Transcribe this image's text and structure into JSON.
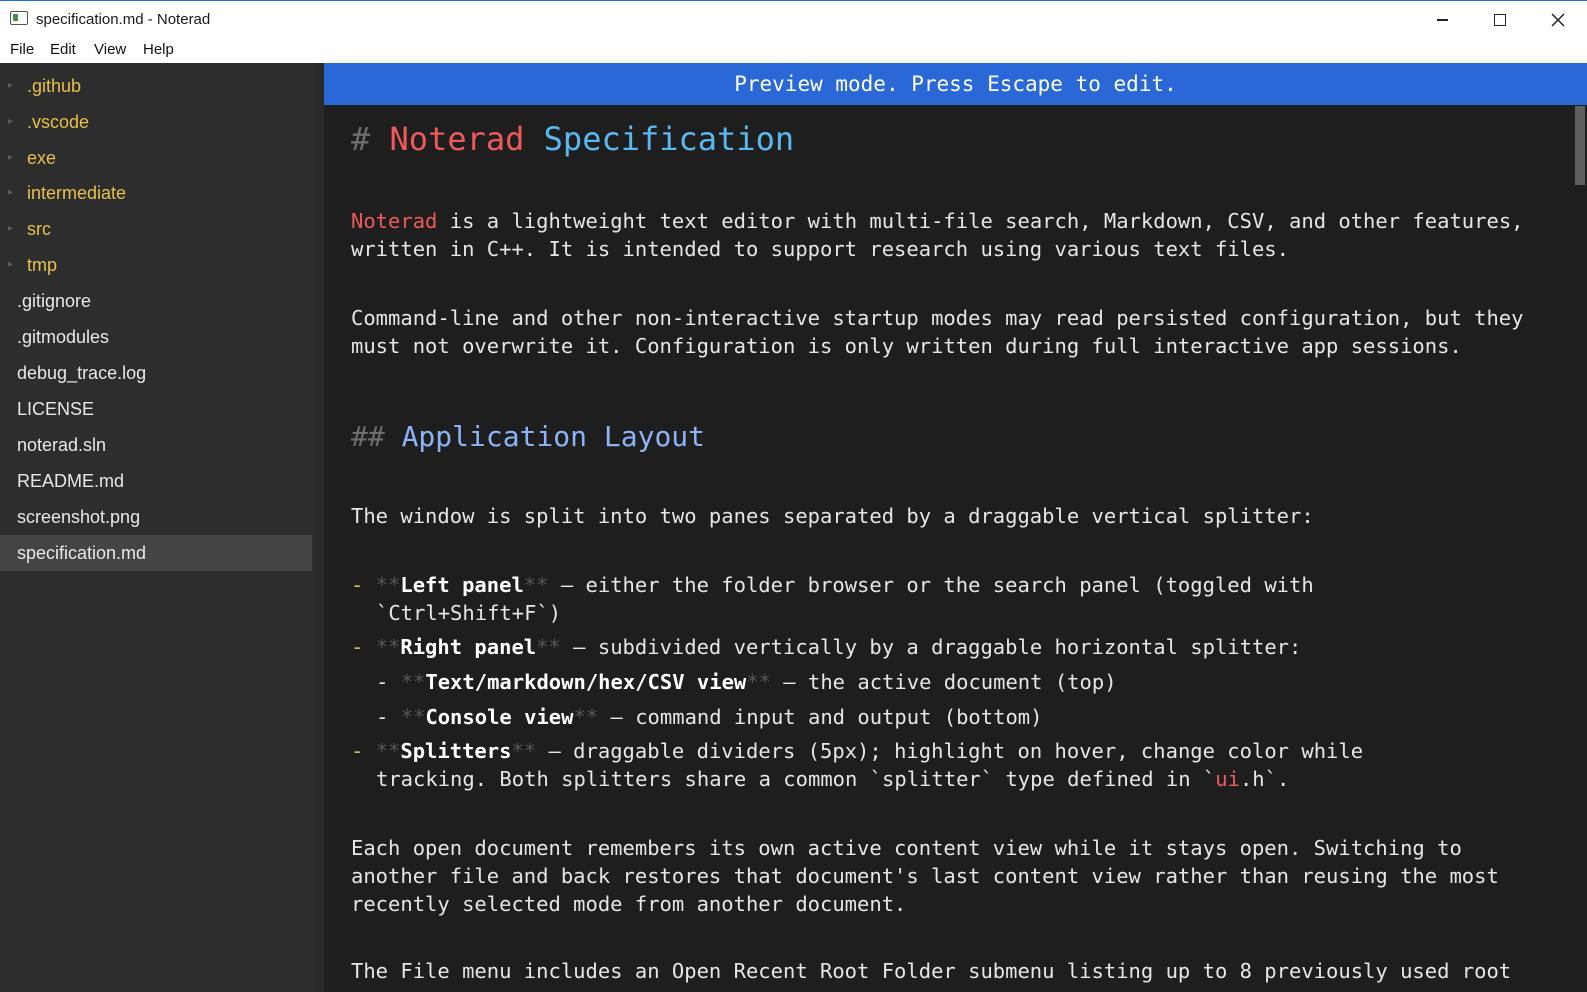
{
  "window": {
    "title": "specification.md - Noterad",
    "minimize_icon": "minimize-icon",
    "maximize_icon": "maximize-icon",
    "close_icon": "close-icon"
  },
  "menu": {
    "file": "File",
    "edit": "Edit",
    "view": "View",
    "help": "Help"
  },
  "sidebar": {
    "folders": [
      ".github",
      ".vscode",
      "exe",
      "intermediate",
      "src",
      "tmp"
    ],
    "files": [
      ".gitignore",
      ".gitmodules",
      "debug_trace.log",
      "LICENSE",
      "noterad.sln",
      "README.md",
      "screenshot.png",
      "specification.md"
    ],
    "selected": "specification.md"
  },
  "banner": "Preview mode. Press Escape to edit.",
  "doc": {
    "h1_hash": "#",
    "h1_word1": "Noterad",
    "h1_word2": "Specification",
    "p1_word": "Noterad",
    "p1_rest": " is a lightweight text editor with multi-file search, Markdown, CSV, and other features,",
    "p1_line2": "written in C++. It is intended to support research using various text files.",
    "p2_line1": "Command-line and other non-interactive startup modes may read persisted configuration, but they",
    "p2_line2": "must not overwrite it. Configuration is only written during full interactive app sessions.",
    "h2_hash": "##",
    "h2_title": "Application Layout",
    "p3": "The window is split into two panes separated by a draggable vertical splitter:",
    "bullet_dash": "-",
    "stars": "**",
    "b1_bold": "Left panel",
    "b1_rest": " — either the folder browser or the search panel (toggled with",
    "b1_line2": "`Ctrl+Shift+F`)",
    "b2_bold": "Right panel",
    "b2_rest": " — subdivided vertically by a draggable horizontal splitter:",
    "b2a_bold": "Text/markdown/hex/CSV view",
    "b2a_rest": " — the active document (top)",
    "b2b_bold": "Console view",
    "b2b_rest": " — command input and output (bottom)",
    "b3_bold": "Splitters",
    "b3_rest": " — draggable dividers (5px); highlight on hover, change color while",
    "b3_line2_a": "tracking. Both splitters share a common `splitter` type defined in `",
    "b3_line2_ui": "ui",
    "b3_line2_b": ".h`.",
    "p4_line1": "Each open document remembers its own active content view while it stays open. Switching to",
    "p4_line2": "another file and back restores that document's last content view rather than reusing the most",
    "p4_line3": "recently selected mode from another document.",
    "p5_line1": "The File menu includes an Open Recent Root Folder submenu listing up to 8 previously used root"
  }
}
